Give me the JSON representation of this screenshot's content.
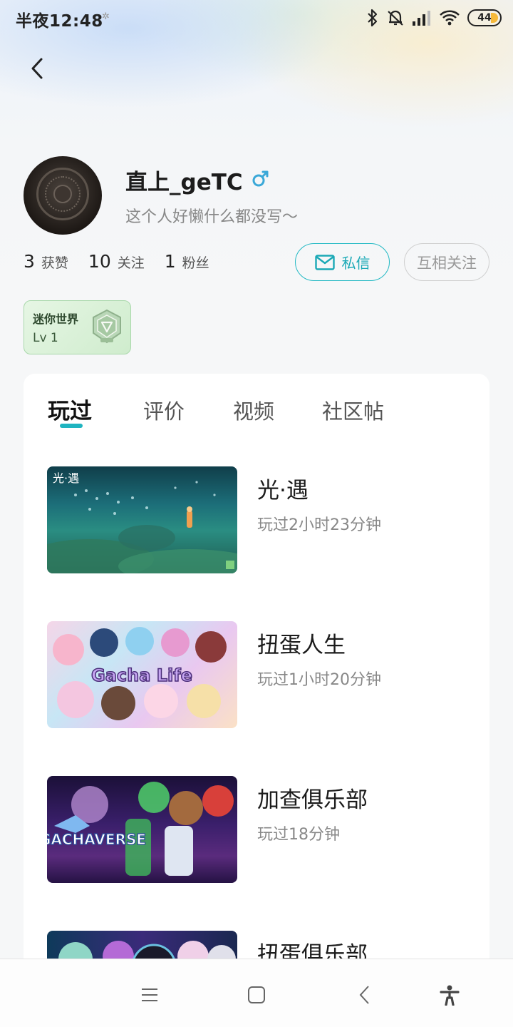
{
  "status_bar": {
    "time": "半夜12:48",
    "battery": "44",
    "icons": [
      "bluetooth-icon",
      "mute-bell-icon",
      "signal-icon",
      "wifi-icon",
      "battery-icon"
    ]
  },
  "profile": {
    "username": "直上_geTC",
    "gender": "male",
    "bio": "这个人好懒什么都没写～",
    "stats": [
      {
        "value": "3",
        "label": "获赞"
      },
      {
        "value": "10",
        "label": "关注"
      },
      {
        "value": "1",
        "label": "粉丝"
      }
    ],
    "message_button": "私信",
    "mutual_follow_button": "互相关注",
    "game_badge": {
      "name": "迷你世界",
      "level": "Lv 1"
    }
  },
  "tabs": [
    {
      "label": "玩过",
      "active": true
    },
    {
      "label": "评价",
      "active": false
    },
    {
      "label": "视频",
      "active": false
    },
    {
      "label": "社区帖",
      "active": false
    }
  ],
  "games": [
    {
      "title": "光·遇",
      "playtime": "玩过2小时23分钟",
      "thumb_text": "光·遇"
    },
    {
      "title": "扭蛋人生",
      "playtime": "玩过1小时20分钟",
      "thumb_text": "Gacha Life"
    },
    {
      "title": "加查俱乐部",
      "playtime": "玩过18分钟",
      "thumb_text": "GACHAVERSE"
    },
    {
      "title": "扭蛋俱乐部",
      "playtime": "",
      "thumb_text": ""
    }
  ],
  "nav_bar": [
    "menu-icon",
    "home-icon",
    "back-icon",
    "accessibility-icon"
  ],
  "colors": {
    "accent": "#1fb4c0",
    "badge_green": "#cfeccd"
  }
}
